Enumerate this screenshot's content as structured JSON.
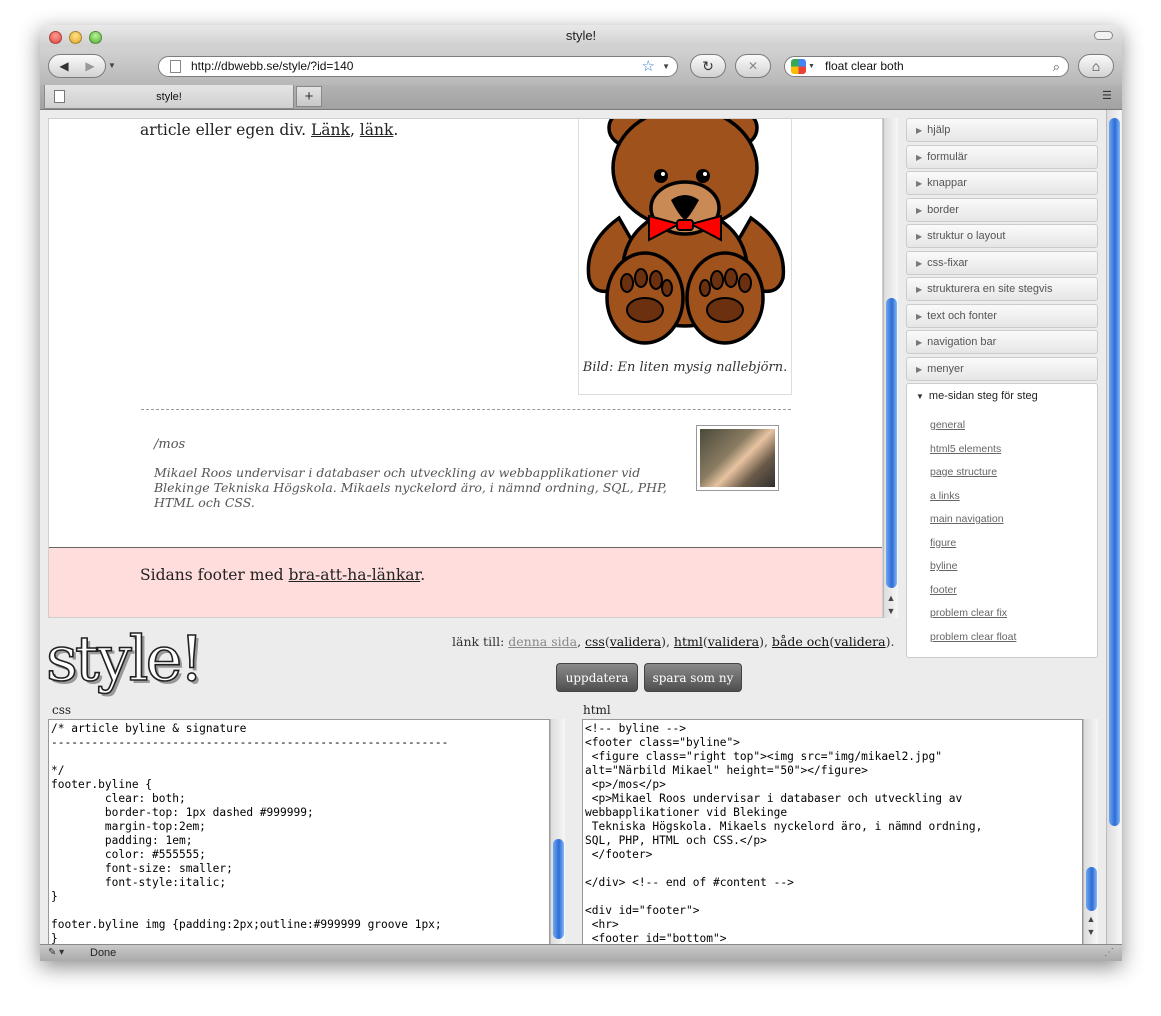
{
  "window": {
    "title": "style!"
  },
  "toolbar": {
    "back_icon": "back-arrow",
    "forward_icon": "forward-arrow",
    "reload_icon": "reload",
    "stop_icon": "stop-x",
    "home_icon": "home",
    "url": "http://dbwebb.se/style/?id=140",
    "search": "float clear both"
  },
  "tabs": {
    "active": "style!",
    "new_tab": "+"
  },
  "page": {
    "intro": "article eller egen div.",
    "link1": "Länk",
    "link2": "länk",
    "figure_caption": "Bild: En liten mysig nallebjörn.",
    "signature": "/mos",
    "bio": "Mikael Roos undervisar i databaser och utveckling av webbapplikationer vid Blekinge Tekniska Högskola. Mikaels nyckelord äro, i nämnd ordning, SQL, PHP, HTML och CSS.",
    "footer_text": "Sidans footer med",
    "footer_link": "bra-att-ha-länkar"
  },
  "sidebar": {
    "items": [
      {
        "label": "hjälp"
      },
      {
        "label": "formulär"
      },
      {
        "label": "knappar"
      },
      {
        "label": "border"
      },
      {
        "label": "struktur o layout"
      },
      {
        "label": "css-fixar"
      },
      {
        "label": "strukturera en site stegvis"
      },
      {
        "label": "text och fonter"
      },
      {
        "label": "navigation bar"
      },
      {
        "label": "menyer"
      }
    ],
    "open_section": "me-sidan steg för steg",
    "links": [
      {
        "label": "general"
      },
      {
        "label": "html5 elements"
      },
      {
        "label": "page structure"
      },
      {
        "label": "a links"
      },
      {
        "label": "main navigation"
      },
      {
        "label": "figure"
      },
      {
        "label": "byline"
      },
      {
        "label": "footer"
      },
      {
        "label": "problem clear fix"
      },
      {
        "label": "problem clear float"
      }
    ]
  },
  "editor": {
    "logo": "style!",
    "link_to": "länk till:",
    "this_page": "denna sida",
    "css": "css",
    "html": "html",
    "both": "både och",
    "validate": "validera",
    "update_button": "uppdatera",
    "save_button": "spara som ny",
    "css_label": "css",
    "html_label": "html",
    "css_code": "/* article byline & signature\n-----------------------------------------------------------\n\n*/\nfooter.byline {\n        clear: both;\n        border-top: 1px dashed #999999;\n        margin-top:2em;\n        padding: 1em;\n        color: #555555;\n        font-size: smaller;\n        font-style:italic;\n}\n\nfooter.byline img {padding:2px;outline:#999999 groove 1px;\n}",
    "html_code": "<!-- byline -->\n<footer class=\"byline\">\n <figure class=\"right top\"><img src=\"img/mikael2.jpg\"\nalt=\"Närbild Mikael\" height=\"50\"></figure>\n <p>/mos</p>\n <p>Mikael Roos undervisar i databaser och utveckling av\nwebbapplikationer vid Blekinge\n Tekniska Högskola. Mikaels nyckelord äro, i nämnd ordning,\nSQL, PHP, HTML och CSS.</p>\n </footer>\n\n</div> <!-- end of #content -->\n\n<div id=\"footer\">\n <hr>\n <footer id=\"bottom\">"
  },
  "status": {
    "text": "Done"
  },
  "colors": {
    "footer_bg": "#ffdddd",
    "scroll_thumb": "#2d6bd6"
  }
}
